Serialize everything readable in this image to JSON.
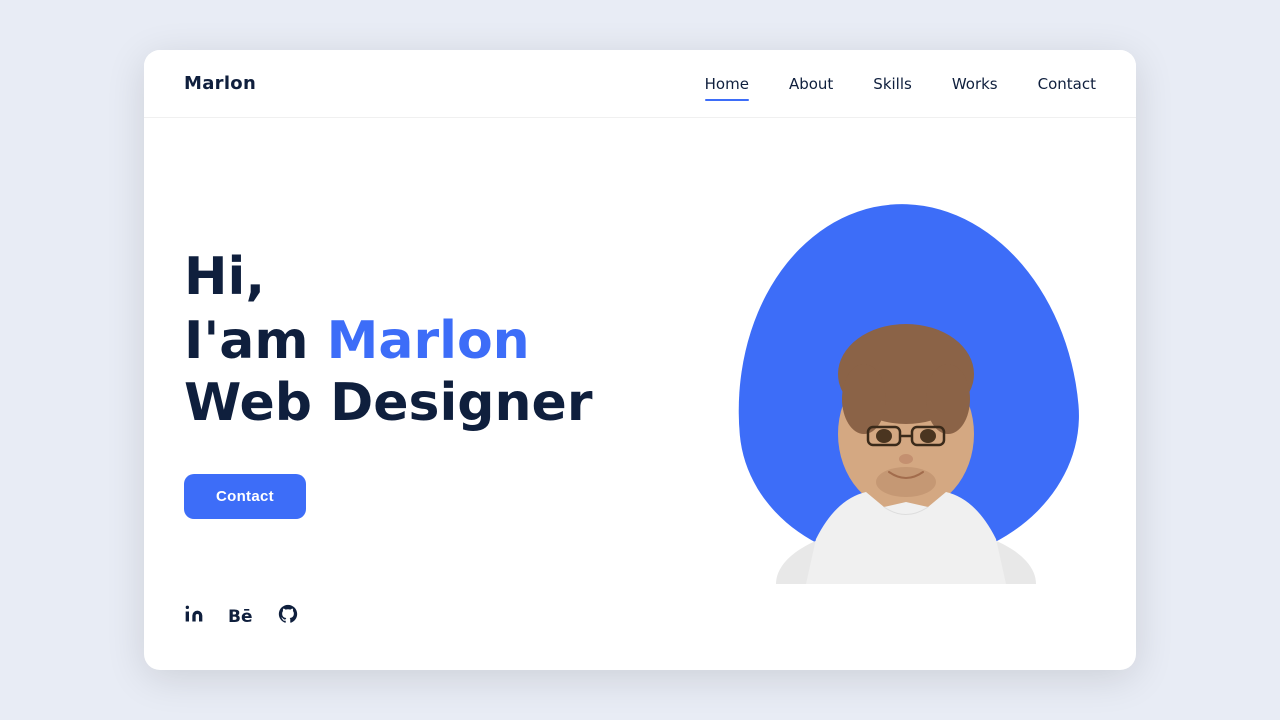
{
  "brand": {
    "name": "Marlon"
  },
  "nav": {
    "links": [
      {
        "id": "home",
        "label": "Home",
        "active": true
      },
      {
        "id": "about",
        "label": "About",
        "active": false
      },
      {
        "id": "skills",
        "label": "Skills",
        "active": false
      },
      {
        "id": "works",
        "label": "Works",
        "active": false
      },
      {
        "id": "contact",
        "label": "Contact",
        "active": false
      }
    ]
  },
  "hero": {
    "greeting": "Hi,",
    "intro": "I'am ",
    "name": "Marlon",
    "role": "Web Designer",
    "cta_label": "Contact"
  },
  "social": {
    "linkedin_label": "in",
    "behance_label": "Bē",
    "github_label": "⌀"
  },
  "colors": {
    "accent": "#3d6df8",
    "dark": "#0f1f3d",
    "bg": "#e8ecf5"
  }
}
